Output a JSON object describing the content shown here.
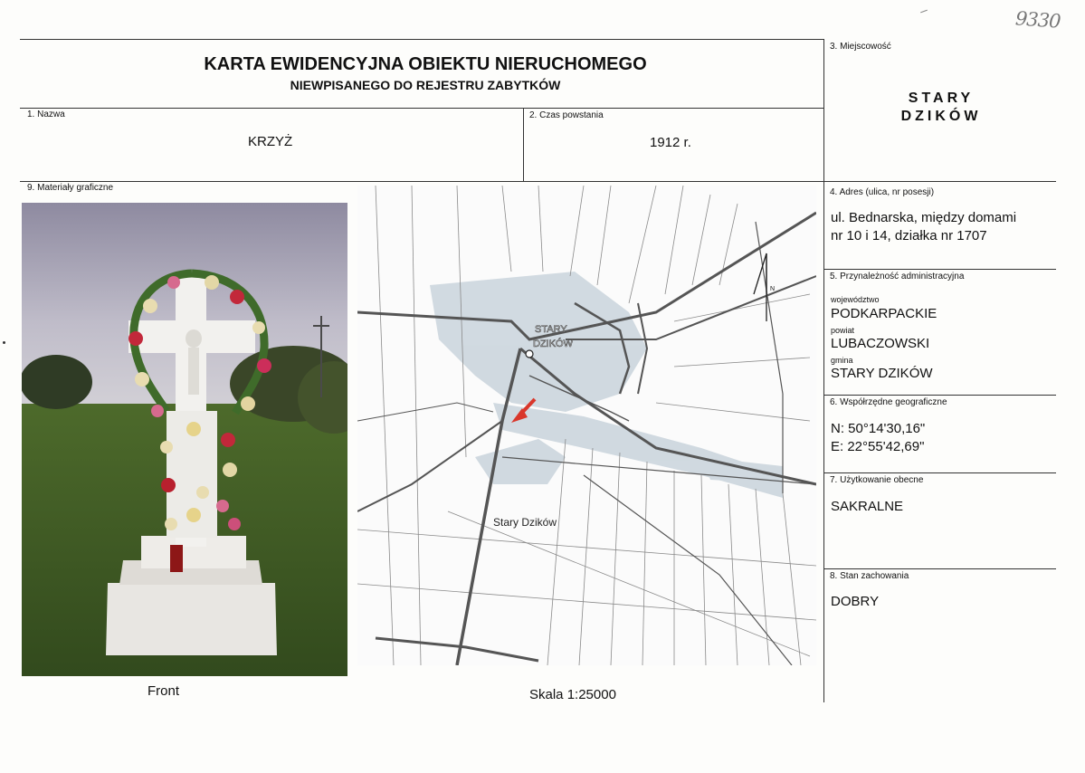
{
  "header": {
    "title": "KARTA EWIDENCYJNA OBIEKTU NIERUCHOMEGO",
    "subtitle": "NIEWPISANEGO DO REJESTRU ZABYTKÓW",
    "hand_number": "9330"
  },
  "fields": {
    "nazwa_label": "1. Nazwa",
    "nazwa_value": "KRZYŻ",
    "czas_label": "2. Czas powstania",
    "czas_value": "1912 r.",
    "miejscowosc_label": "3. Miejscowość",
    "miejscowosc_line1": "STARY",
    "miejscowosc_line2": "DZIKÓW",
    "adres_label": "4. Adres (ulica, nr posesji)",
    "adres_line1": "ul. Bednarska, między domami",
    "adres_line2": "nr 10 i 14, działka nr 1707",
    "admin_label": "5. Przynależność administracyjna",
    "wojewodztwo_label": "województwo",
    "wojewodztwo_value": "PODKARPACKIE",
    "powiat_label": "powiat",
    "powiat_value": "LUBACZOWSKI",
    "gmina_label": "gmina",
    "gmina_value": "STARY DZIKÓW",
    "geo_label": "6. Współrzędne geograficzne",
    "geo_n": "N:  50°14'30,16\"",
    "geo_e": "E:  22°55'42,69\"",
    "uzytkowanie_label": "7. Użytkowanie obecne",
    "uzytkowanie_value": "SAKRALNE",
    "stan_label": "8. Stan zachowania",
    "stan_value": "DOBRY",
    "materialy_label": "9. Materiały graficzne"
  },
  "graphics": {
    "photo_caption": "Front",
    "map_caption": "Skala 1:25000",
    "map_town_label_1": "STARY",
    "map_town_label_2": "DZIKÓW",
    "map_place_label": "Stary Dzików",
    "north_letter": "N"
  },
  "colors": {
    "marker_arrow": "#d9372b",
    "map_roads": "#555555",
    "map_builtup": "#c9d4dc"
  }
}
